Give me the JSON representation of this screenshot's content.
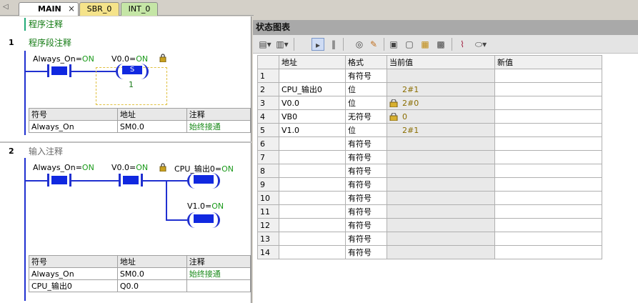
{
  "tabs": [
    {
      "label": "MAIN",
      "close": "×"
    },
    {
      "label": "SBR_0"
    },
    {
      "label": "INT_0"
    }
  ],
  "tab_nav": "◁",
  "editor": {
    "program_comment": "程序注释",
    "networks": [
      {
        "number": "1",
        "title": "程序段注释",
        "contact1": {
          "name": "Always_On",
          "value": "ON"
        },
        "coil": {
          "name": "V0.0",
          "value": "ON",
          "text": "S",
          "count": "1"
        },
        "symbols": {
          "headers": [
            "符号",
            "地址",
            "注释"
          ],
          "rows": [
            [
              "Always_On",
              "SM0.0",
              "始终接通"
            ]
          ]
        }
      },
      {
        "number": "2",
        "title": "输入注释",
        "contact1": {
          "name": "Always_On",
          "value": "ON"
        },
        "contact2": {
          "name": "V0.0",
          "value": "ON"
        },
        "coil1": {
          "name": "CPU_输出0",
          "value": "ON"
        },
        "coil2": {
          "name": "V1.0",
          "value": "ON"
        },
        "symbols": {
          "headers": [
            "符号",
            "地址",
            "注释"
          ],
          "rows": [
            [
              "Always_On",
              "SM0.0",
              "始终接通"
            ],
            [
              "CPU_输出0",
              "Q0.0",
              ""
            ]
          ]
        }
      }
    ]
  },
  "status_chart": {
    "title": "状态图表",
    "headers": [
      "",
      "地址",
      "格式",
      "当前值",
      "新值"
    ],
    "rows": [
      {
        "n": "1",
        "addr": "",
        "fmt": "有符号",
        "cur": "",
        "locked": false
      },
      {
        "n": "2",
        "addr": "CPU_输出0",
        "fmt": "位",
        "cur": "2#1",
        "locked": false
      },
      {
        "n": "3",
        "addr": "V0.0",
        "fmt": "位",
        "cur": "2#0",
        "locked": true
      },
      {
        "n": "4",
        "addr": "VB0",
        "fmt": "无符号",
        "cur": "0",
        "locked": true
      },
      {
        "n": "5",
        "addr": "V1.0",
        "fmt": "位",
        "cur": "2#1",
        "locked": false
      },
      {
        "n": "6",
        "addr": "",
        "fmt": "有符号",
        "cur": "",
        "locked": false
      },
      {
        "n": "7",
        "addr": "",
        "fmt": "有符号",
        "cur": "",
        "locked": false
      },
      {
        "n": "8",
        "addr": "",
        "fmt": "有符号",
        "cur": "",
        "locked": false
      },
      {
        "n": "9",
        "addr": "",
        "fmt": "有符号",
        "cur": "",
        "locked": false
      },
      {
        "n": "10",
        "addr": "",
        "fmt": "有符号",
        "cur": "",
        "locked": false
      },
      {
        "n": "11",
        "addr": "",
        "fmt": "有符号",
        "cur": "",
        "locked": false
      },
      {
        "n": "12",
        "addr": "",
        "fmt": "有符号",
        "cur": "",
        "locked": false
      },
      {
        "n": "13",
        "addr": "",
        "fmt": "有符号",
        "cur": "",
        "locked": false
      },
      {
        "n": "14",
        "addr": "",
        "fmt": "有符号",
        "cur": "",
        "locked": false
      }
    ]
  },
  "colors": {
    "rail": "#2030d0",
    "contact_fill": "#1028e0",
    "on_value": "#1a9a1a",
    "comment": "#127a12"
  },
  "toolbar_icons": [
    "insert-row-icon",
    "delete-row-icon",
    "chart-run-icon",
    "pause-icon",
    "view-icon",
    "write-icon",
    "lock-icon",
    "unlock-icon",
    "unlock-all-icon",
    "read-locked-icon",
    "trend-icon",
    "tag-icon"
  ]
}
